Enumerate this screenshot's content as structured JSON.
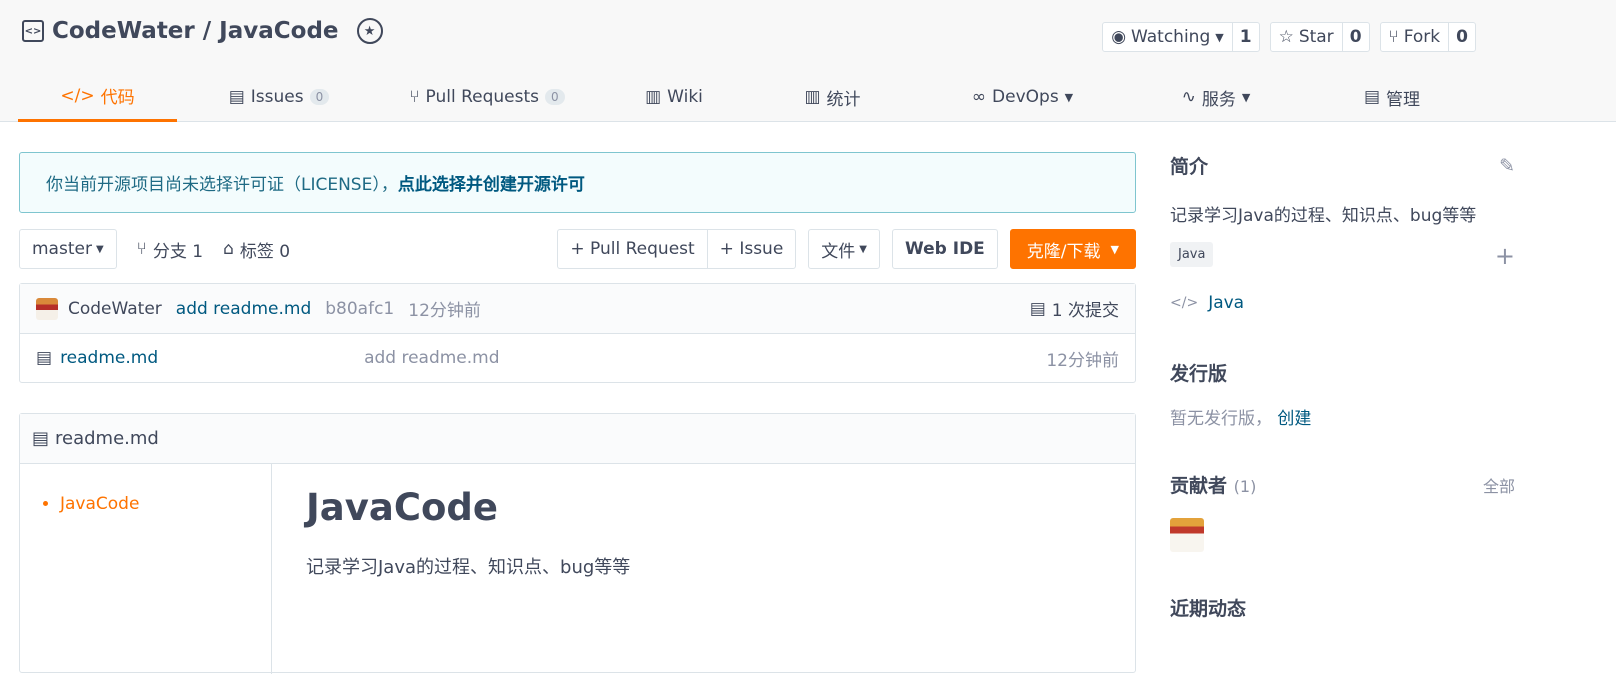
{
  "repo": {
    "title": "CodeWater / JavaCode"
  },
  "actions": {
    "watch_label": "Watching",
    "watch_count": "1",
    "star_label": "Star",
    "star_count": "0",
    "fork_label": "Fork",
    "fork_count": "0"
  },
  "tabs": [
    {
      "label": "代码"
    },
    {
      "label": "Issues",
      "count": "0"
    },
    {
      "label": "Pull Requests",
      "count": "0"
    },
    {
      "label": "Wiki"
    },
    {
      "label": "统计"
    },
    {
      "label": "DevOps"
    },
    {
      "label": "服务"
    },
    {
      "label": "管理"
    }
  ],
  "notice": {
    "text": "你当前开源项目尚未选择许可证（LICENSE），",
    "link": "点此选择并创建开源许可"
  },
  "toolbar": {
    "branch": "master",
    "branches": "分支 1",
    "tags": "标签 0",
    "pull_request": "+ Pull Request",
    "issue": "+ Issue",
    "file": "文件",
    "web_ide": "Web IDE",
    "clone": "克隆/下载"
  },
  "commit": {
    "author": "CodeWater",
    "message": "add readme.md",
    "hash": "b80afc1",
    "time": "12分钟前",
    "count": "1 次提交"
  },
  "files": [
    {
      "name": "readme.md",
      "message": "add readme.md",
      "time": "12分钟前"
    }
  ],
  "readme": {
    "filename": "readme.md",
    "toc": [
      "JavaCode"
    ],
    "heading": "JavaCode",
    "body": "记录学习Java的过程、知识点、bug等等"
  },
  "sidebar": {
    "intro_title": "简介",
    "intro_desc": "记录学习Java的过程、知识点、bug等等",
    "tag": "Java",
    "language": "Java",
    "release_title": "发行版",
    "release_text": "暂无发行版，",
    "release_create": "创建",
    "contributors_title": "贡献者",
    "contributors_count": "(1)",
    "contributors_all": "全部",
    "activity_title": "近期动态"
  },
  "colors": {
    "accent": "#fe7300",
    "link": "#005980"
  }
}
